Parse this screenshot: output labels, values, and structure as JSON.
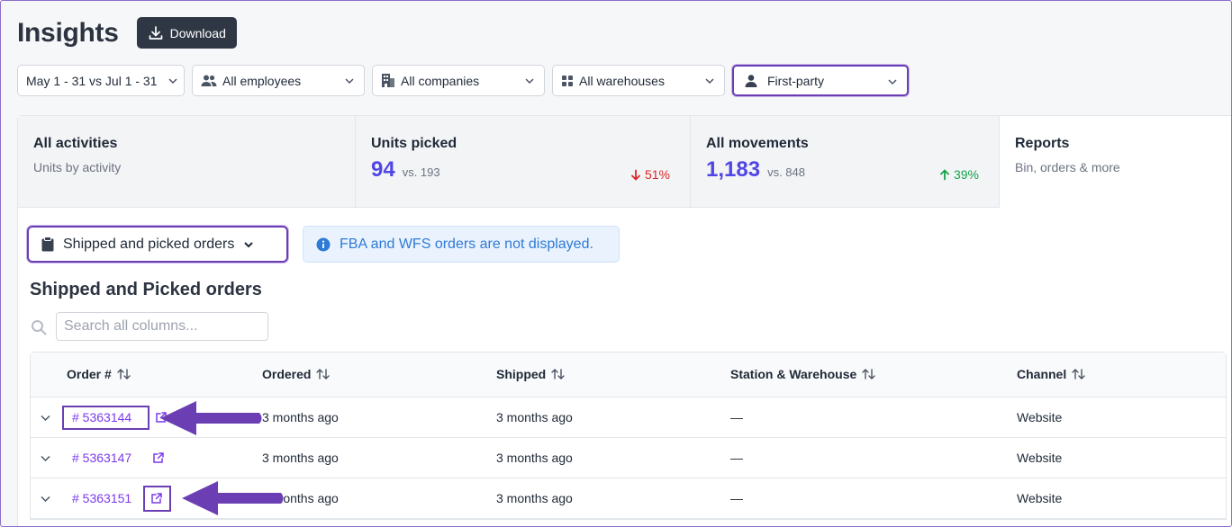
{
  "header": {
    "title": "Insights",
    "download_label": "Download"
  },
  "filters": [
    {
      "label": "May 1 - 31 vs Jul 1 - 31",
      "icon": "none"
    },
    {
      "label": "All employees",
      "icon": "users-icon"
    },
    {
      "label": "All companies",
      "icon": "building-icon"
    },
    {
      "label": "All warehouses",
      "icon": "grid-icon"
    },
    {
      "label": "First-party",
      "icon": "user-icon"
    }
  ],
  "tabs": [
    {
      "title": "All activities",
      "sub": "Units by activity"
    },
    {
      "title": "Units picked",
      "value": "94",
      "vs": "vs. 193",
      "delta": "51%",
      "direction": "down"
    },
    {
      "title": "All movements",
      "value": "1,183",
      "vs": "vs. 848",
      "delta": "39%",
      "direction": "up"
    },
    {
      "title": "Reports",
      "sub": "Bin, orders & more"
    }
  ],
  "report_select": {
    "label": "Shipped and picked orders"
  },
  "notice": {
    "text": "FBA and WFS orders are not displayed."
  },
  "section": {
    "title": "Shipped and Picked orders"
  },
  "search": {
    "placeholder": "Search all columns..."
  },
  "table": {
    "headers": [
      "Order #",
      "Ordered",
      "Shipped",
      "Station & Warehouse",
      "Channel"
    ],
    "rows": [
      {
        "order": "# 5363144",
        "ordered": "3 months ago",
        "shipped": "3 months ago",
        "station": "—",
        "channel": "Website"
      },
      {
        "order": "# 5363147",
        "ordered": "3 months ago",
        "shipped": "3 months ago",
        "station": "—",
        "channel": "Website"
      },
      {
        "order": "# 5363151",
        "ordered": "3 months ago",
        "shipped": "3 months ago",
        "station": "—",
        "channel": "Website"
      }
    ]
  },
  "colors": {
    "accent": "#6b3fb3",
    "metric": "#4f46e5",
    "down": "#dc2626",
    "up": "#16a34a",
    "link": "#7c3aed"
  }
}
